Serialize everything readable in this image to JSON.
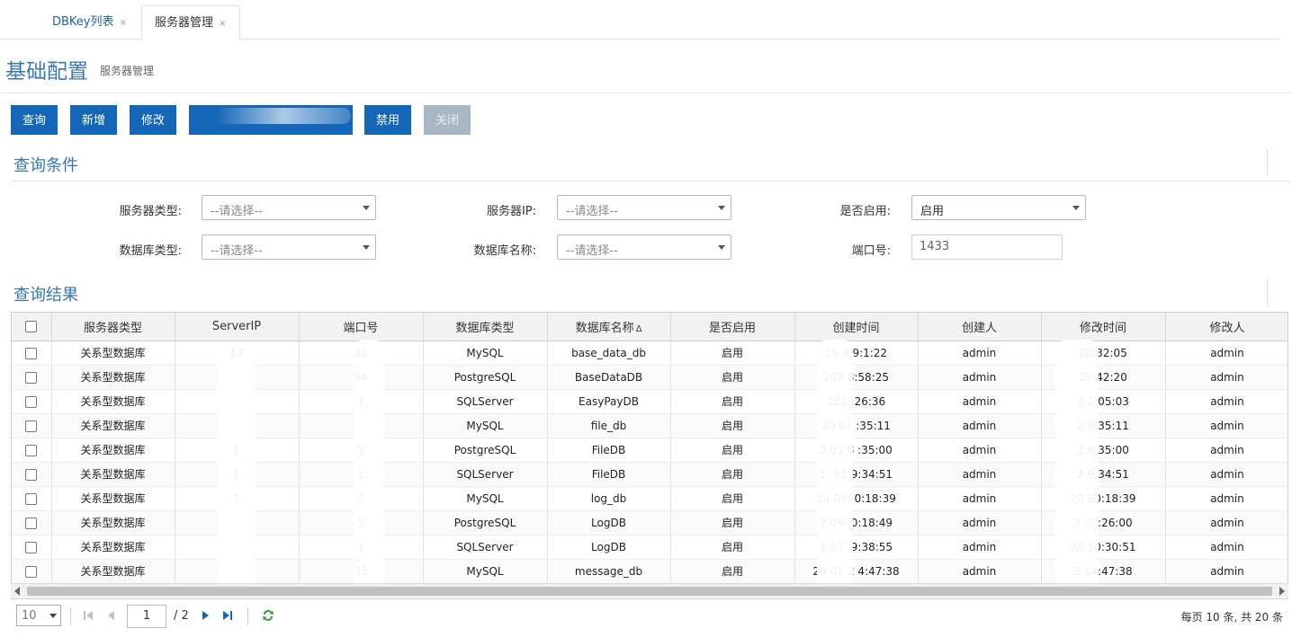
{
  "tabs": [
    {
      "label": "DBKey列表",
      "close": "×"
    },
    {
      "label": "服务器管理",
      "close": "×"
    }
  ],
  "header": {
    "title": "基础配置",
    "subtitle": "服务器管理"
  },
  "toolbar": {
    "query": "查询",
    "add": "新增",
    "edit": "修改",
    "masked": "",
    "disable": "禁用",
    "close": "关闭"
  },
  "filter": {
    "title": "查询条件",
    "server_type": {
      "label": "服务器类型:",
      "value": "--请选择--"
    },
    "server_ip": {
      "label": "服务器IP:",
      "value": "--请选择--"
    },
    "enabled": {
      "label": "是否启用:",
      "value": "启用"
    },
    "db_type": {
      "label": "数据库类型:",
      "value": "--请选择--"
    },
    "db_name": {
      "label": "数据库名称:",
      "value": "--请选择--"
    },
    "port": {
      "label": "端口号:",
      "value": "1433"
    }
  },
  "results": {
    "title": "查询结果",
    "columns": [
      "服务器类型",
      "ServerIP",
      "端口号",
      "数据库类型",
      "数据库名称",
      "是否启用",
      "创建时间",
      "创建人",
      "修改时间",
      "修改人"
    ],
    "sort_indicator": "Δ",
    "rows": [
      {
        "type": "关系型数据库",
        "ip": "17",
        "port": "33",
        "dbtype": "MySQL",
        "dbname": "base_data_db",
        "enabled": "启用",
        "created": "20 9 9:1:22",
        "creator": "admin",
        "modified": "20 32:05",
        "modifier": "admin"
      },
      {
        "type": "关系型数据库",
        "ip": "",
        "port": "54",
        "dbtype": "PostgreSQL",
        "dbname": "BaseDataDB",
        "enabled": "启用",
        "created": "202 8:58:25",
        "creator": "admin",
        "modified": "20 42:20",
        "modifier": "admin"
      },
      {
        "type": "关系型数据库",
        "ip": "",
        "port": "1",
        "dbtype": "SQLServer",
        "dbname": "EasyPayDB",
        "enabled": "启用",
        "created": "202 :26:36",
        "creator": "admin",
        "modified": "2 2:05:03",
        "modifier": "admin"
      },
      {
        "type": "关系型数据库",
        "ip": "",
        "port": "",
        "dbtype": "MySQL",
        "dbname": "file_db",
        "enabled": "启用",
        "created": "20 01 :35:11",
        "creator": "admin",
        "modified": "2 9:35:11",
        "modifier": "admin"
      },
      {
        "type": "关系型数据库",
        "ip": "1",
        "port": "5",
        "dbtype": "PostgreSQL",
        "dbname": "FileDB",
        "enabled": "启用",
        "created": "2 01 8 :35:00",
        "creator": "admin",
        "modified": "2 9:35:00",
        "modifier": "admin"
      },
      {
        "type": "关系型数据库",
        "ip": "1",
        "port": "1",
        "dbtype": "SQLServer",
        "dbname": "FileDB",
        "enabled": "启用",
        "created": "2 -01 9:34:51",
        "creator": "admin",
        "modified": "2 9:34:51",
        "modifier": "admin"
      },
      {
        "type": "关系型数据库",
        "ip": "1",
        "port": "3",
        "dbtype": "MySQL",
        "dbname": "log_db",
        "enabled": "启用",
        "created": "20 09- 0:18:39",
        "creator": "admin",
        "modified": "20 20:18:39",
        "modifier": "admin"
      },
      {
        "type": "关系型数据库",
        "ip": "",
        "port": "5",
        "dbtype": "PostgreSQL",
        "dbname": "LogDB",
        "enabled": "启用",
        "created": "2 09- 0:18:49",
        "creator": "admin",
        "modified": "2 20:26:00",
        "modifier": "admin"
      },
      {
        "type": "关系型数据库",
        "ip": "",
        "port": "1",
        "dbtype": "SQLServer",
        "dbname": "LogDB",
        "enabled": "启用",
        "created": "2 07- 9:38:55",
        "creator": "admin",
        "modified": "20 10:30:51",
        "modifier": "admin"
      },
      {
        "type": "关系型数据库",
        "ip": "",
        "port": "33",
        "dbtype": "MySQL",
        "dbname": "message_db",
        "enabled": "启用",
        "created": "20 01-2 4:47:38",
        "creator": "admin",
        "modified": "2 14:47:38",
        "modifier": "admin"
      }
    ]
  },
  "pager": {
    "page_size": "10",
    "current_page": "1",
    "total_pages": "/ 2",
    "info": "每页 10 条, 共 20 条"
  },
  "colors": {
    "primary": "#1466b8",
    "title": "#3a77b1",
    "disabled": "#a9b7c5"
  },
  "icons": [
    "close-icon",
    "dropdown-caret-icon",
    "first-page-icon",
    "prev-page-icon",
    "next-page-icon",
    "last-page-icon",
    "refresh-icon"
  ]
}
